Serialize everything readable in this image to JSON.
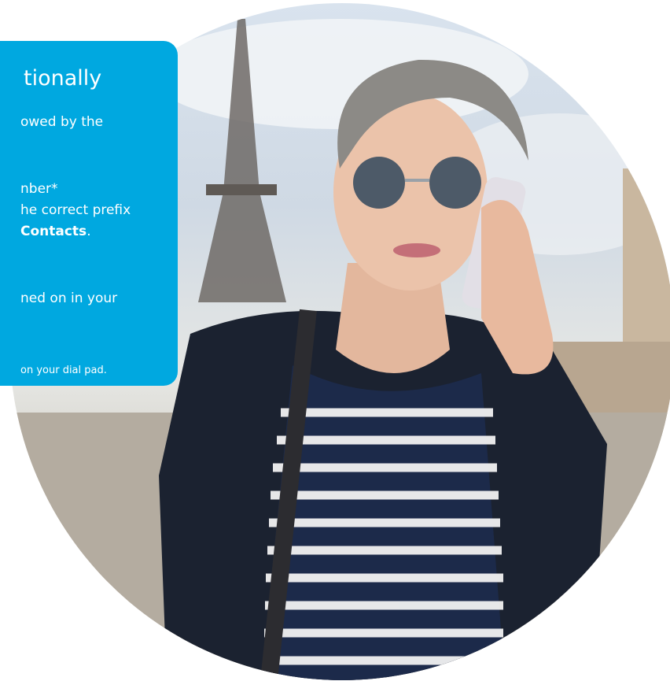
{
  "panel": {
    "title": "tionally",
    "lines": [
      "owed by the",
      "nber*",
      "he correct prefix",
      "Contacts",
      ".",
      "ned on in your",
      "on your dial pad."
    ]
  },
  "colors": {
    "panel_bg": "#00a8e0",
    "panel_text": "#ffffff"
  },
  "photo": {
    "description_icon": "woman-on-phone-photo"
  }
}
